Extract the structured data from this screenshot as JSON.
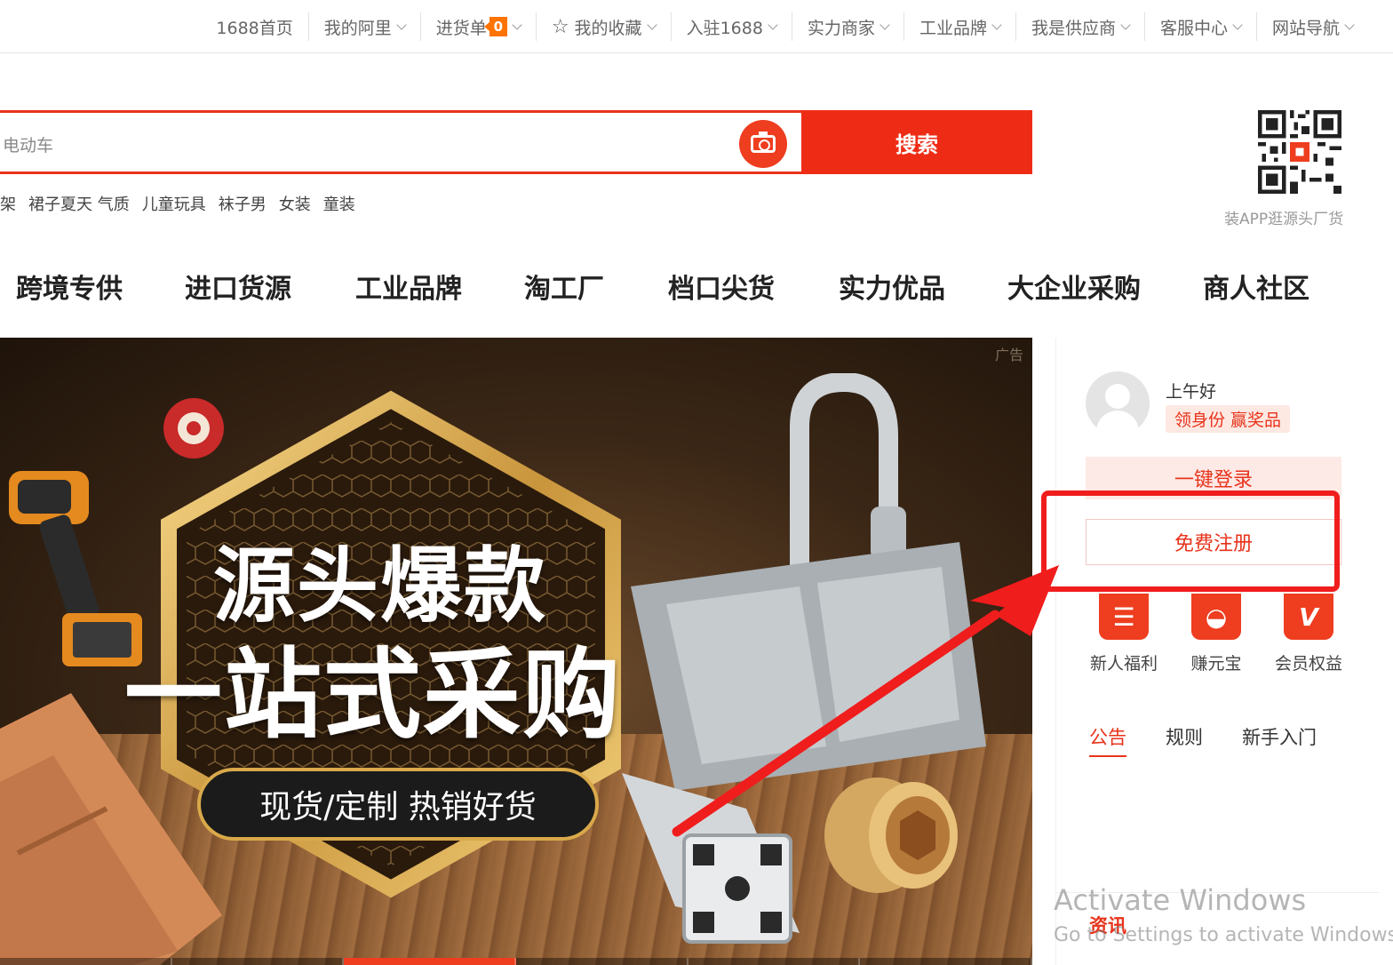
{
  "topbar": {
    "items": [
      {
        "label": "1688首页",
        "chevron": false
      },
      {
        "label": "我的阿里",
        "chevron": true
      },
      {
        "label": "进货单",
        "chevron": true,
        "badge": "0"
      },
      {
        "label": "我的收藏",
        "chevron": true,
        "icon": "star-icon"
      },
      {
        "label": "入驻1688",
        "chevron": true
      },
      {
        "label": "实力商家",
        "chevron": true
      },
      {
        "label": "工业品牌",
        "chevron": true
      },
      {
        "label": "我是供应商",
        "chevron": true
      },
      {
        "label": "客服中心",
        "chevron": true
      },
      {
        "label": "网站导航",
        "chevron": true
      }
    ]
  },
  "search": {
    "value": "电动车",
    "button_label": "搜索",
    "camera_icon": "camera-icon",
    "hotwords": [
      "架",
      "裙子夏天 气质",
      "儿童玩具",
      "袜子男",
      "女装",
      "童装"
    ]
  },
  "qr": {
    "caption": "装APP逛源头厂货"
  },
  "nav": {
    "items": [
      "跨境专供",
      "进口货源",
      "工业品牌",
      "淘工厂",
      "档口尖货",
      "实力优品",
      "大企业采购",
      "商人社区"
    ]
  },
  "banner": {
    "ad_tag": "广告",
    "title_line1": "源头爆款",
    "title_line2": "一站式采购",
    "pill_text": "现货/定制 热销好货",
    "slides": 6,
    "active_slide": 2
  },
  "user_panel": {
    "greeting": "上午好",
    "reward_tag": "领身份 赢奖品",
    "login_label": "一键登录",
    "register_label": "免费注册",
    "quick_links": [
      {
        "label": "新人福利",
        "icon": "gift-card-icon",
        "glyph": "☰"
      },
      {
        "label": "赚元宝",
        "icon": "ingot-icon",
        "glyph": "◒"
      },
      {
        "label": "会员权益",
        "icon": "vip-icon",
        "glyph": "V"
      }
    ],
    "tabs": [
      {
        "label": "公告",
        "active": true
      },
      {
        "label": "规则",
        "active": false
      },
      {
        "label": "新手入门",
        "active": false
      }
    ],
    "news_label": "资讯"
  },
  "watermark": {
    "line1": "Activate Windows",
    "line2": "Go to Settings to activate Windows."
  },
  "colors": {
    "brand_red": "#ee2c16",
    "accent_orange": "#ff7300",
    "annotation_red": "#f01d1d"
  }
}
